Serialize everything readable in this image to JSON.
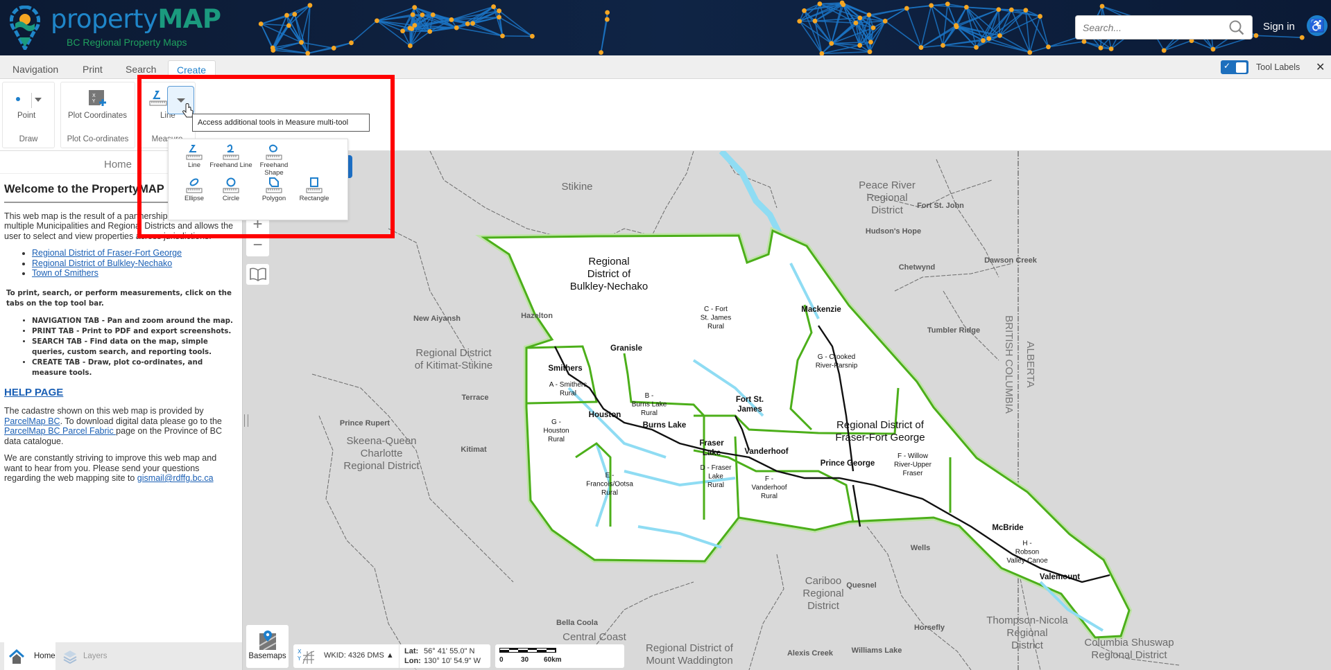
{
  "header": {
    "brand_main": "property",
    "brand_accent": "MAP",
    "subtitle": "BC Regional Property Maps",
    "search_placeholder": "Search...",
    "sign_in": "Sign in",
    "accessibility_icon": "wheelchair-icon",
    "colors": {
      "bg": "#0c1a33",
      "network_line": "#1b74c4",
      "network_node": "#f5a623",
      "brand_blue": "#1f86c9",
      "brand_green": "#1b9a7e"
    }
  },
  "tabs": [
    {
      "label": "Navigation",
      "active": false
    },
    {
      "label": "Print",
      "active": false
    },
    {
      "label": "Search",
      "active": false
    },
    {
      "label": "Create",
      "active": true
    }
  ],
  "tool_labels": {
    "label": "Tool Labels",
    "checked": true
  },
  "ribbon": {
    "groups": [
      {
        "label": "Draw",
        "tool": "Point"
      },
      {
        "label": "Plot Co-ordinates",
        "tool": "Plot Coordinates"
      },
      {
        "label": "Measure",
        "tool": "Line"
      }
    ],
    "tooltip": "Access additional tools in Measure multi-tool",
    "measure_menu": [
      "Line",
      "Freehand Line",
      "Freehand Shape",
      "Ellipse",
      "Circle",
      "Polygon",
      "Rectangle"
    ]
  },
  "left_panel": {
    "title": "Home",
    "heading": "Welcome to the PropertyMAP",
    "intro": "This web map is the result of a partnership between multiple Municipalities and Regional Districts and allows the user to select and view properties across jurisdictions.",
    "links": [
      "Regional District of Fraser-Fort George",
      "Regional District of Bulkley-Nechako",
      "Town of Smithers"
    ],
    "instructions": "To print, search, or perform measurements, click on the tabs on the top tool bar.",
    "tab_help": [
      "NAVIGATION TAB - Pan and zoom around the map.",
      "PRINT TAB - Print to PDF and export screenshots.",
      "SEARCH TAB - Find data on the map, simple queries, custom search, and reporting tools.",
      "CREATE TAB - Draw, plot co-ordinates, and measure tools."
    ],
    "help_link": "HELP PAGE",
    "cadastre": {
      "t1": "The cadastre shown on this web map is provided by ",
      "link1": "ParcelMap BC",
      "t2": ".  To download digital data please go to the ",
      "link2": "ParcelMap BC Parcel Fabric ",
      "t3": "page on the Province of BC data catalogue."
    },
    "contact": {
      "text": "We are constantly striving to improve this web map and want to hear from you.  Please send your questions regarding the web mapping site to ",
      "email": "gismail@rdffg.bc.ca"
    }
  },
  "bottom_tabs": [
    {
      "label": "Home",
      "active": true
    },
    {
      "label": "Layers",
      "active": false
    }
  ],
  "map": {
    "basemaps_label": "Basemaps",
    "wkid": "WKID: 4326 DMS ▲",
    "lat_label": "Lat:",
    "lat": "56° 41' 55.0\" N",
    "lon_label": "Lon:",
    "lon": "130° 10' 54.9\" W",
    "scale_ticks": [
      "0",
      "30",
      "60km"
    ],
    "colors": {
      "background": "#d9d9d9",
      "district_fill": "#ffffff",
      "district_border": "#4caf1a",
      "water": "#8fdcf3",
      "road": "#111111"
    },
    "labels": [
      {
        "lines": [
          "Stikine"
        ],
        "style": "region"
      },
      {
        "lines": [
          "Peace River",
          "Regional",
          "District"
        ],
        "style": "region"
      },
      {
        "lines": [
          "Fort St. John"
        ],
        "style": "town"
      },
      {
        "lines": [
          "Hudson's Hope"
        ],
        "style": "town"
      },
      {
        "lines": [
          "Dawson Creek"
        ],
        "style": "town"
      },
      {
        "lines": [
          "Chetwynd"
        ],
        "style": "town"
      },
      {
        "lines": [
          "Tumbler Ridge"
        ],
        "style": "town"
      },
      {
        "lines": [
          "BRITISH COLUMBIA"
        ],
        "style": "province"
      },
      {
        "lines": [
          "ALBERTA"
        ],
        "style": "province"
      },
      {
        "lines": [
          "New Aiyansh"
        ],
        "style": "town"
      },
      {
        "lines": [
          "Hazelton"
        ],
        "style": "town"
      },
      {
        "lines": [
          "Regional District",
          "of Kitimat-Stikine"
        ],
        "style": "region"
      },
      {
        "lines": [
          "Terrace"
        ],
        "style": "town"
      },
      {
        "lines": [
          "Prince Rupert"
        ],
        "style": "town"
      },
      {
        "lines": [
          "Skeena-Queen",
          "Charlotte",
          "Regional District"
        ],
        "style": "region"
      },
      {
        "lines": [
          "Kitimat"
        ],
        "style": "town"
      },
      {
        "lines": [
          "Wells"
        ],
        "style": "town"
      },
      {
        "lines": [
          "Quesnel"
        ],
        "style": "town"
      },
      {
        "lines": [
          "Cariboo",
          "Regional",
          "District"
        ],
        "style": "region"
      },
      {
        "lines": [
          "Bella Coola"
        ],
        "style": "town"
      },
      {
        "lines": [
          "Central Coast"
        ],
        "style": "region"
      },
      {
        "lines": [
          "Regional District of",
          "Mount Waddington"
        ],
        "style": "region"
      },
      {
        "lines": [
          "Alexis Creek"
        ],
        "style": "town"
      },
      {
        "lines": [
          "Williams Lake"
        ],
        "style": "town"
      },
      {
        "lines": [
          "Horsefly"
        ],
        "style": "town"
      },
      {
        "lines": [
          "Thompson-Nicola",
          "Regional",
          "District"
        ],
        "style": "region"
      },
      {
        "lines": [
          "Columbia Shuswap",
          "Regional District"
        ],
        "style": "region"
      },
      {
        "lines": [
          "Regional",
          "District of",
          "Bulkley-Nechako"
        ],
        "style": "rd"
      },
      {
        "lines": [
          "C - Fort",
          "St. James",
          "Rural"
        ],
        "style": "area"
      },
      {
        "lines": [
          "Mackenzie"
        ],
        "style": "muni"
      },
      {
        "lines": [
          "Granisle"
        ],
        "style": "muni"
      },
      {
        "lines": [
          "Smithers"
        ],
        "style": "muni"
      },
      {
        "lines": [
          "A - Smithers",
          "Rural"
        ],
        "style": "area"
      },
      {
        "lines": [
          "G - Crooked",
          "River-Parsnip"
        ],
        "style": "area"
      },
      {
        "lines": [
          "B -",
          "Burns Lake",
          "Rural"
        ],
        "style": "area"
      },
      {
        "lines": [
          "Houston"
        ],
        "style": "muni"
      },
      {
        "lines": [
          "Fort St.",
          "James"
        ],
        "style": "muni"
      },
      {
        "lines": [
          "Regional District of",
          "Fraser-Fort George"
        ],
        "style": "rd"
      },
      {
        "lines": [
          "Burns Lake"
        ],
        "style": "muni"
      },
      {
        "lines": [
          "G -",
          "Houston",
          "Rural"
        ],
        "style": "area"
      },
      {
        "lines": [
          "Fraser",
          "Lake"
        ],
        "style": "muni"
      },
      {
        "lines": [
          "Vanderhoof"
        ],
        "style": "muni"
      },
      {
        "lines": [
          "Prince George"
        ],
        "style": "muni"
      },
      {
        "lines": [
          "F - Willow",
          "River-Upper",
          "Fraser"
        ],
        "style": "area"
      },
      {
        "lines": [
          "D - Fraser",
          "Lake",
          "Rural"
        ],
        "style": "area"
      },
      {
        "lines": [
          "E -",
          "Francois/Ootsa",
          "Rural"
        ],
        "style": "area"
      },
      {
        "lines": [
          "F -",
          "Vanderhoof",
          "Rural"
        ],
        "style": "area"
      },
      {
        "lines": [
          "McBride"
        ],
        "style": "muni"
      },
      {
        "lines": [
          "H -",
          "Robson",
          "Valley-Canoe"
        ],
        "style": "area"
      },
      {
        "lines": [
          "Valemount"
        ],
        "style": "muni"
      }
    ]
  }
}
